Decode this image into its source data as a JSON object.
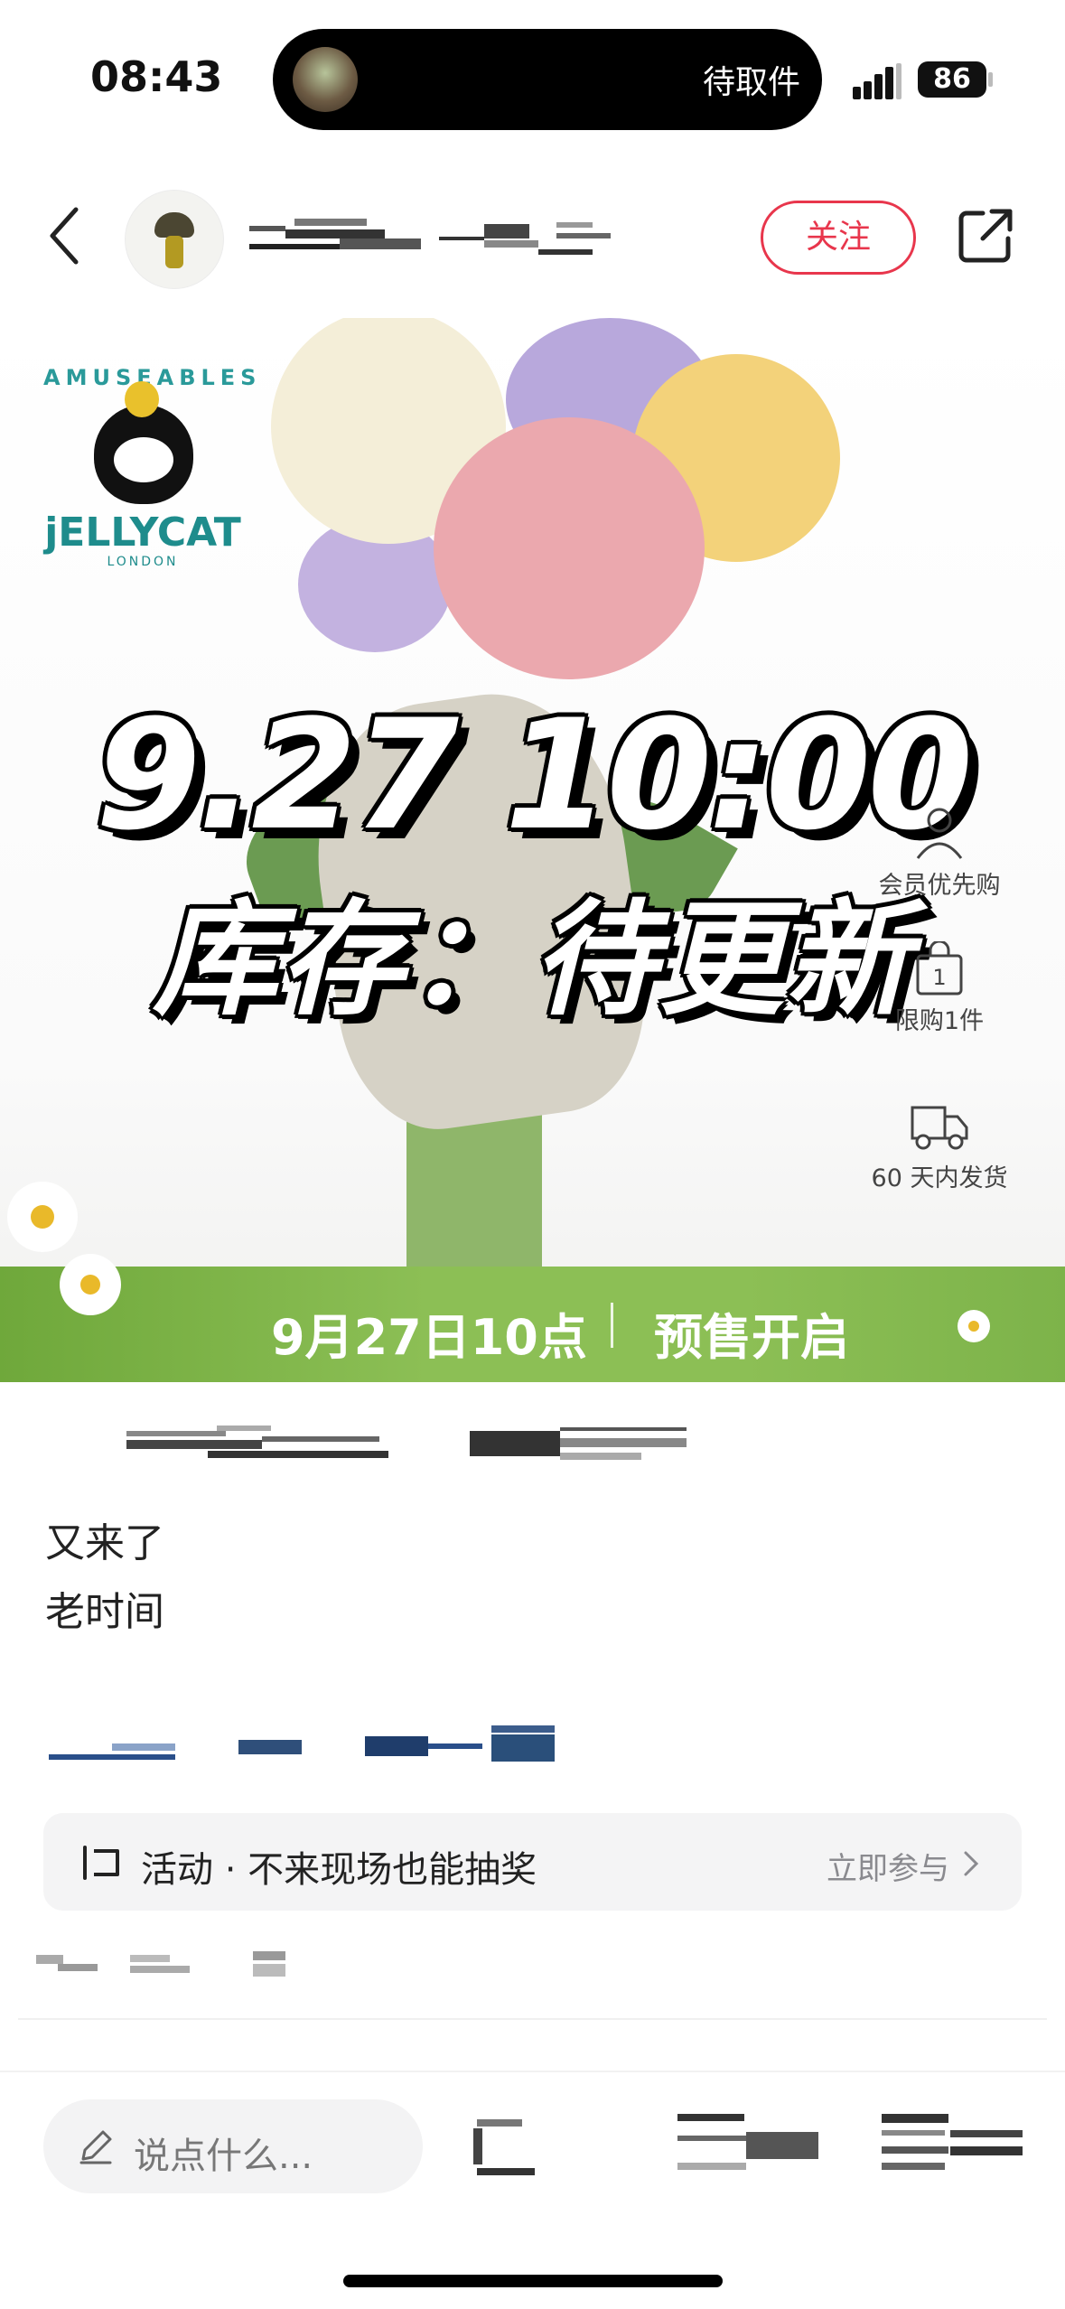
{
  "status_bar": {
    "time": "08:43",
    "island_text": "待取件",
    "battery": "86"
  },
  "header": {
    "follow_label": "关注"
  },
  "hero": {
    "brand_arc": "AMUSEABLES",
    "brand_name": "jELLYCAT",
    "brand_city": "LONDON",
    "time_text": "9.27 10:00",
    "stock_text": "库存：待更新",
    "side_items": [
      "会员优先购",
      "限购1件",
      "60 天内发货"
    ],
    "banner_left": "9月27日10点",
    "banner_right": "预售开启"
  },
  "post": {
    "lines": [
      "又来了",
      "老时间"
    ]
  },
  "activity": {
    "label": "活动 · 不来现场也能抽奖",
    "action": "立即参与"
  },
  "bottom_bar": {
    "comment_placeholder": "说点什么..."
  },
  "colors": {
    "accent": "#e8364c",
    "banner_green": "#8cbf55"
  }
}
